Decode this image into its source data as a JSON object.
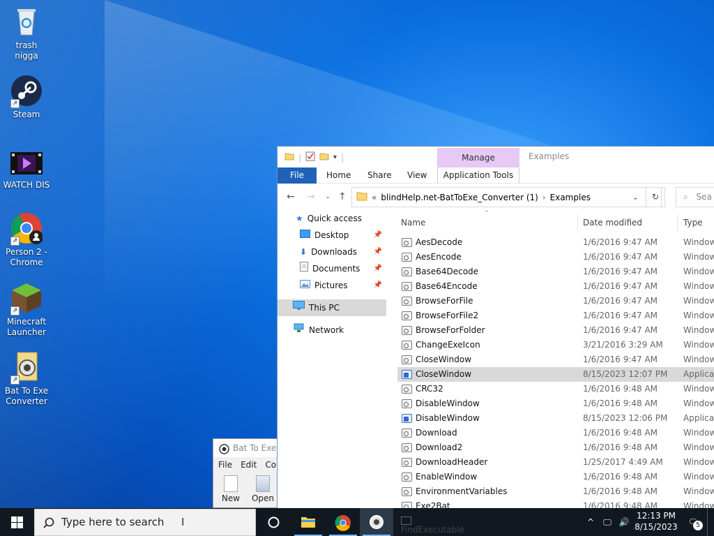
{
  "desktop": {
    "icons": [
      {
        "label": "trash nigga"
      },
      {
        "label": "Steam"
      },
      {
        "label": "WATCH DIS"
      },
      {
        "label": "Person 2 - Chrome"
      },
      {
        "label": "Minecraft Launcher"
      },
      {
        "label": "Bat To Exe Converter"
      }
    ]
  },
  "explorer": {
    "window_title": "Examples",
    "manage_tab": "Manage",
    "ribbon_tabs": [
      "File",
      "Home",
      "Share",
      "View"
    ],
    "app_tools": "Application Tools",
    "address": {
      "prefix": "«",
      "parent": "blindHelp.net-BatToExe_Converter (1)",
      "separator": "›",
      "current": "Examples"
    },
    "search_placeholder": "Sea",
    "nav": {
      "quick_access": "Quick access",
      "desktop": "Desktop",
      "downloads": "Downloads",
      "documents": "Documents",
      "pictures": "Pictures",
      "this_pc": "This PC",
      "network": "Network"
    },
    "columns": {
      "name": "Name",
      "date": "Date modified",
      "type": "Type"
    },
    "files": [
      {
        "name": "AesDecode",
        "date": "1/6/2016 9:47 AM",
        "type": "Window",
        "app": false
      },
      {
        "name": "AesEncode",
        "date": "1/6/2016 9:47 AM",
        "type": "Window",
        "app": false
      },
      {
        "name": "Base64Decode",
        "date": "1/6/2016 9:47 AM",
        "type": "Window",
        "app": false
      },
      {
        "name": "Base64Encode",
        "date": "1/6/2016 9:47 AM",
        "type": "Window",
        "app": false
      },
      {
        "name": "BrowseForFile",
        "date": "1/6/2016 9:47 AM",
        "type": "Window",
        "app": false
      },
      {
        "name": "BrowseForFile2",
        "date": "1/6/2016 9:47 AM",
        "type": "Window",
        "app": false
      },
      {
        "name": "BrowseForFolder",
        "date": "1/6/2016 9:47 AM",
        "type": "Window",
        "app": false
      },
      {
        "name": "ChangeExeIcon",
        "date": "3/21/2016 3:29 AM",
        "type": "Window",
        "app": false
      },
      {
        "name": "CloseWindow",
        "date": "1/6/2016 9:47 AM",
        "type": "Window",
        "app": false
      },
      {
        "name": "CloseWindow",
        "date": "8/15/2023 12:07 PM",
        "type": "Applicat",
        "app": true,
        "selected": true
      },
      {
        "name": "CRC32",
        "date": "1/6/2016 9:48 AM",
        "type": "Window",
        "app": false
      },
      {
        "name": "DisableWindow",
        "date": "1/6/2016 9:48 AM",
        "type": "Window",
        "app": false
      },
      {
        "name": "DisableWindow",
        "date": "8/15/2023 12:06 PM",
        "type": "Applicat",
        "app": true
      },
      {
        "name": "Download",
        "date": "1/6/2016 9:48 AM",
        "type": "Window",
        "app": false
      },
      {
        "name": "Download2",
        "date": "1/6/2016 9:48 AM",
        "type": "Window",
        "app": false
      },
      {
        "name": "DownloadHeader",
        "date": "1/25/2017 4:49 AM",
        "type": "Window",
        "app": false
      },
      {
        "name": "EnableWindow",
        "date": "1/6/2016 9:48 AM",
        "type": "Window",
        "app": false
      },
      {
        "name": "EnvironmentVariables",
        "date": "1/6/2016 9:48 AM",
        "type": "Window",
        "app": false
      },
      {
        "name": "Exe2Bat",
        "date": "1/6/2016 9:48 AM",
        "type": "Window",
        "app": false
      }
    ]
  },
  "batwin": {
    "title": "Bat To Exe C",
    "menu": [
      "File",
      "Edit",
      "Cor"
    ],
    "tools": [
      "New",
      "Open"
    ]
  },
  "taskbar": {
    "search_placeholder": "Type here to search",
    "peek_label": "FindExecutable",
    "time": "12:13 PM",
    "date": "8/15/2023",
    "notification_count": "5"
  }
}
